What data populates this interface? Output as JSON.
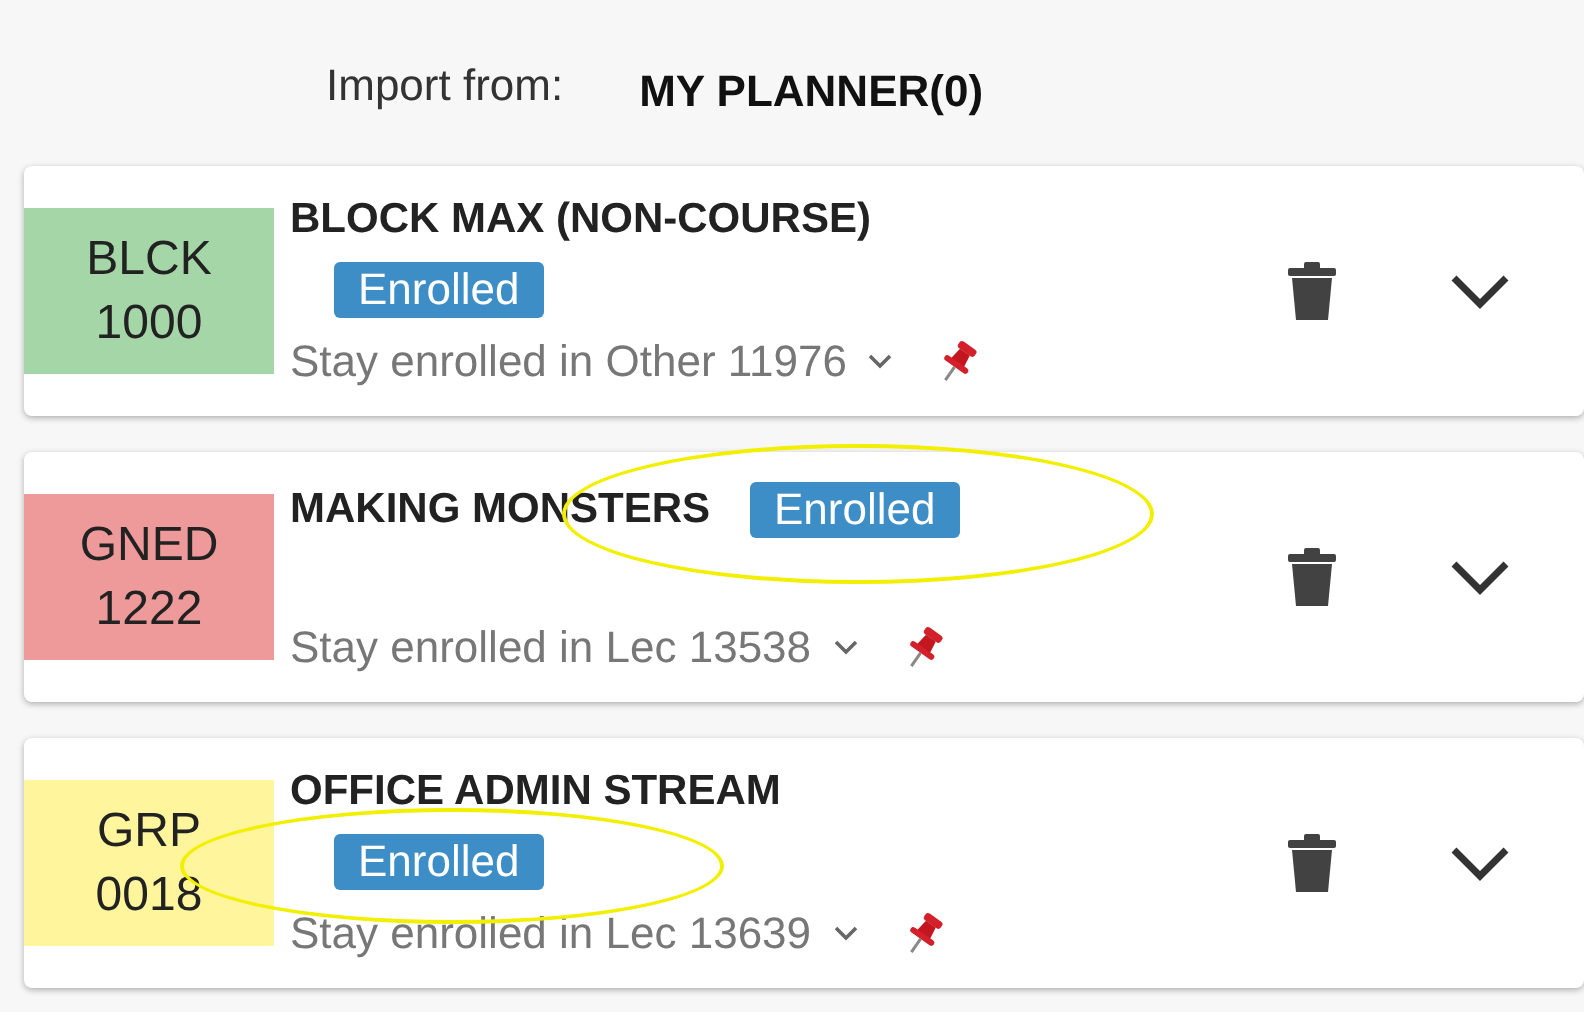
{
  "import": {
    "label": "Import from:",
    "source": "MY PLANNER(0)"
  },
  "courses": [
    {
      "code": [
        "BLCK",
        "1000"
      ],
      "color": "#a5d6a7",
      "title": "BLOCK MAX (NON-COURSE)",
      "badge": "Enrolled",
      "kind": "stacked",
      "circled": false,
      "section": "Stay enrolled in Other 11976"
    },
    {
      "code": [
        "GNED",
        "1222"
      ],
      "color": "#ef9a9a",
      "title": "MAKING MONSTERS",
      "badge": "Enrolled",
      "kind": "inline",
      "circled": true,
      "section": "Stay enrolled in Lec 13538"
    },
    {
      "code": [
        "GRP",
        "0018"
      ],
      "color": "#fff59d",
      "title": "OFFICE ADMIN STREAM",
      "badge": "Enrolled",
      "kind": "stacked",
      "circled": true,
      "section": "Stay enrolled in Lec 13639"
    }
  ]
}
